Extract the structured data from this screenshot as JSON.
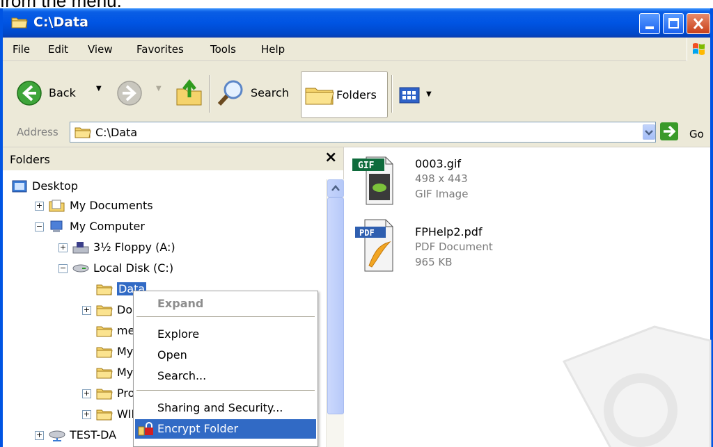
{
  "caption": "from the menu.",
  "window": {
    "title": "C:\\Data"
  },
  "menubar": [
    "File",
    "Edit",
    "View",
    "Favorites",
    "Tools",
    "Help"
  ],
  "toolbar": {
    "back": "Back",
    "search": "Search",
    "folders": "Folders"
  },
  "address": {
    "label": "Address",
    "value": "C:\\Data",
    "go": "Go"
  },
  "folders_pane": {
    "title": "Folders",
    "close": "×",
    "tree": [
      {
        "label": "Desktop",
        "icon": "desktop-icon"
      },
      {
        "label": "My Documents",
        "icon": "my-documents-icon"
      },
      {
        "label": "My Computer",
        "icon": "my-computer-icon"
      },
      {
        "label": "3½ Floppy (A:)",
        "icon": "floppy-drive-icon"
      },
      {
        "label": "Local Disk (C:)",
        "icon": "hard-drive-icon"
      },
      {
        "label": "Data",
        "icon": "folder-icon",
        "selected": true
      },
      {
        "label": "Docu",
        "icon": "folder-icon"
      },
      {
        "label": "me-n",
        "icon": "folder-icon"
      },
      {
        "label": "My D",
        "icon": "folder-icon"
      },
      {
        "label": "My M",
        "icon": "folder-icon"
      },
      {
        "label": "Prog",
        "icon": "folder-icon"
      },
      {
        "label": "WINI",
        "icon": "folder-icon"
      },
      {
        "label": "TEST-DA",
        "icon": "network-drive-icon"
      }
    ]
  },
  "files": [
    {
      "name": "0003.gif",
      "line2": "498 x 443",
      "line3": "GIF Image",
      "icon": "gif-file-icon",
      "badge": "GIF"
    },
    {
      "name": "FPHelp2.pdf",
      "line2": "PDF Document",
      "line3": "965 KB",
      "icon": "pdf-file-icon",
      "badge": "PDF"
    }
  ],
  "context_menu": {
    "items": [
      {
        "label": "Expand",
        "disabled": true
      },
      {
        "label": "Explore"
      },
      {
        "label": "Open"
      },
      {
        "label": "Search..."
      },
      {
        "label": "Sharing and Security..."
      },
      {
        "label": "Encrypt Folder",
        "highlighted": true,
        "icon": "lock-icon"
      }
    ]
  },
  "colors": {
    "titlebar": "#0054e3",
    "selection": "#316ac5",
    "folder": "#f5d36b"
  }
}
